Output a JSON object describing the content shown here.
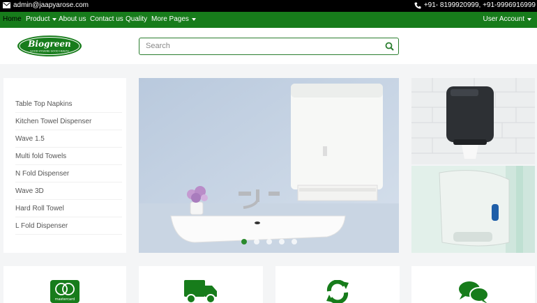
{
  "topbar": {
    "email": "admin@jaapyarose.com",
    "phone": "+91- 8199920999, +91-9996916999",
    "icons": [
      "mail-icon",
      "phone-icon"
    ]
  },
  "nav": {
    "home": "Home",
    "product": "Product",
    "about": "About us",
    "contact": "Contact us",
    "quality": "Quality",
    "more": "More Pages",
    "account": "User Account"
  },
  "header": {
    "logo_text": "Biogreen",
    "logo_tagline": "GOOD HYGIENE GOOD HEALTH",
    "search_placeholder": "Search"
  },
  "sidebar": {
    "items": [
      "Table Top Napkins",
      "Kitchen Towel Dispenser",
      "Wave 1.5",
      "Multi fold Towels",
      "N Fold Dispenser",
      "Wave 3D",
      "Hard Roll Towel",
      "L Fold Dispenser"
    ]
  },
  "carousel": {
    "slide_count": 5,
    "active_index": 0
  },
  "features": {
    "card1_badge": "mastercard",
    "icons": [
      "mastercard-icon",
      "truck-icon",
      "refresh-icon",
      "chat-icon"
    ]
  },
  "colors": {
    "brand_green": "#177c1b",
    "topbar_black": "#000000"
  }
}
